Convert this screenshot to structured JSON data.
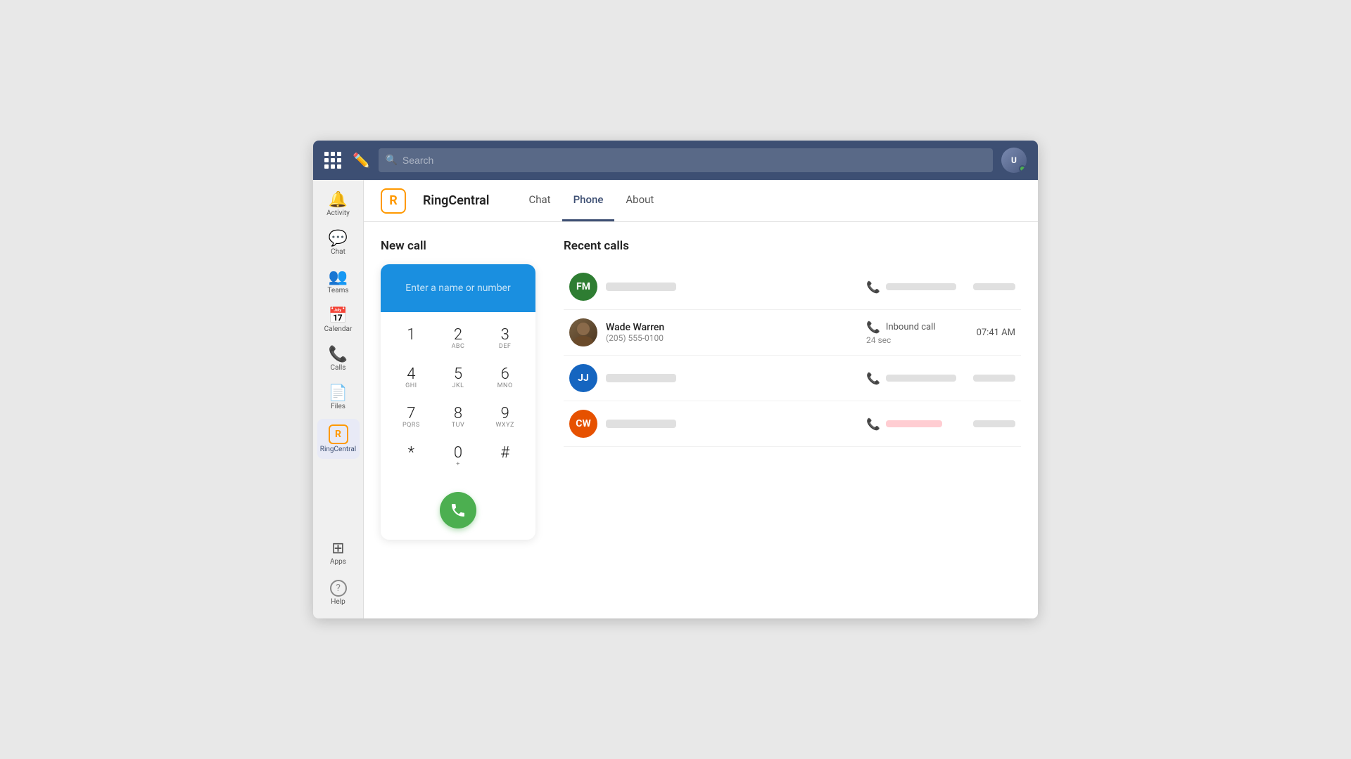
{
  "topbar": {
    "search_placeholder": "Search"
  },
  "sidebar": {
    "items": [
      {
        "id": "activity",
        "label": "Activity",
        "icon": "🔔",
        "active": false
      },
      {
        "id": "chat",
        "label": "Chat",
        "icon": "💬",
        "active": false
      },
      {
        "id": "teams",
        "label": "Teams",
        "icon": "👥",
        "active": false
      },
      {
        "id": "calendar",
        "label": "Calendar",
        "icon": "📅",
        "active": false
      },
      {
        "id": "calls",
        "label": "Calls",
        "icon": "📞",
        "active": false
      },
      {
        "id": "files",
        "label": "Files",
        "icon": "📄",
        "active": false
      },
      {
        "id": "ringcentral",
        "label": "RingCentral",
        "icon": "R",
        "active": true
      }
    ],
    "bottom_items": [
      {
        "id": "apps",
        "label": "Apps",
        "icon": "⊞"
      },
      {
        "id": "help",
        "label": "Help",
        "icon": "?"
      }
    ]
  },
  "app_header": {
    "logo_letter": "R",
    "app_name": "RingCentral",
    "tabs": [
      {
        "id": "chat",
        "label": "Chat",
        "active": false
      },
      {
        "id": "phone",
        "label": "Phone",
        "active": true
      },
      {
        "id": "about",
        "label": "About",
        "active": false
      }
    ]
  },
  "new_call": {
    "title": "New call",
    "placeholder": "Enter a name or number",
    "keys": [
      {
        "num": "1",
        "letters": ""
      },
      {
        "num": "2",
        "letters": "ABC"
      },
      {
        "num": "3",
        "letters": "DEF"
      },
      {
        "num": "4",
        "letters": "GHI"
      },
      {
        "num": "5",
        "letters": "JKL"
      },
      {
        "num": "6",
        "letters": "MNO"
      },
      {
        "num": "7",
        "letters": "PQRS"
      },
      {
        "num": "8",
        "letters": "TUV"
      },
      {
        "num": "9",
        "letters": "WXYZ"
      },
      {
        "num": "*",
        "letters": ""
      },
      {
        "num": "0",
        "letters": "+"
      },
      {
        "num": "#",
        "letters": ""
      }
    ]
  },
  "recent_calls": {
    "title": "Recent calls",
    "items": [
      {
        "id": "1",
        "initials": "FM",
        "avatar_color": "#2e7d32",
        "name": null,
        "number": null,
        "call_type": null,
        "duration": null,
        "time": null,
        "missed": false
      },
      {
        "id": "2",
        "initials": null,
        "avatar_color": null,
        "has_photo": true,
        "name": "Wade Warren",
        "number": "(205) 555-0100",
        "call_type": "Inbound call",
        "duration": "24 sec",
        "time": "07:41 AM",
        "missed": false
      },
      {
        "id": "3",
        "initials": "JJ",
        "avatar_color": "#1565c0",
        "name": null,
        "number": null,
        "call_type": null,
        "duration": null,
        "time": null,
        "missed": false
      },
      {
        "id": "4",
        "initials": "CW",
        "avatar_color": "#e65100",
        "name": null,
        "number": null,
        "call_type": null,
        "duration": null,
        "time": null,
        "missed": true
      }
    ]
  }
}
